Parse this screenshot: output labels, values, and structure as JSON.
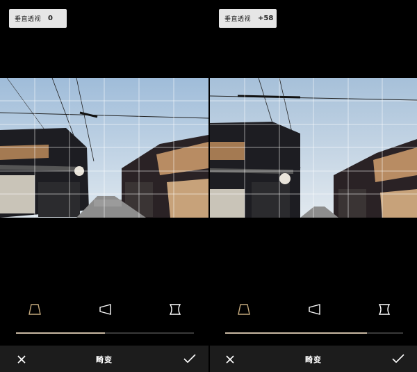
{
  "screens": [
    {
      "id": "before",
      "badge": {
        "label": "垂直透视",
        "value": "0"
      },
      "slider_fraction": 0.5,
      "bottom": {
        "title": "畸变"
      }
    },
    {
      "id": "after",
      "badge": {
        "label": "垂直透视",
        "value": "+58"
      },
      "slider_fraction": 0.68,
      "bottom": {
        "title": "畸变"
      }
    }
  ],
  "icons": {
    "vertical": "trapezoid-vertical-icon",
    "horizontal": "trapezoid-horizontal-icon",
    "distortion": "barrel-distortion-icon",
    "close": "close-icon",
    "confirm": "check-icon"
  },
  "colors": {
    "accent": "#c9b9a3",
    "active_icon": "#c4a97d",
    "bar_bg": "#1c1c1c",
    "badge_bg": "#e6e6e6"
  }
}
